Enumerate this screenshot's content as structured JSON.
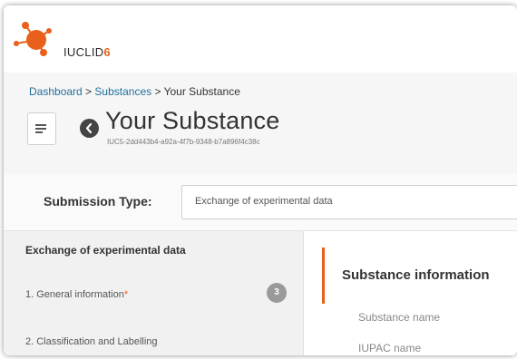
{
  "app": {
    "logo_name": "IUCLID",
    "logo_version": "6",
    "brand_color": "#e8601c"
  },
  "breadcrumb": {
    "dashboard": "Dashboard",
    "sep1": " > ",
    "substances": "Substances",
    "sep2": " > ",
    "current": "Your Substance"
  },
  "page": {
    "title": "Your Substance",
    "uuid": "IUC5-2dd443b4-a92a-4f7b-9348-b7a896f4c38c"
  },
  "submission": {
    "label": "Submission Type:",
    "value": "Exchange of experimental data"
  },
  "sections": {
    "title": "Exchange of experimental data",
    "items": [
      {
        "label": "1. General information",
        "required_mark": "*",
        "badge": "3"
      },
      {
        "label": "2. Classification and Labelling"
      }
    ]
  },
  "detail": {
    "title": "Substance information",
    "fields": [
      "Substance name",
      "IUPAC name"
    ]
  },
  "icons": {
    "menu": "hamburger-menu-icon",
    "back": "back-arrow-icon",
    "logo": "iuclid-molecule-logo"
  }
}
